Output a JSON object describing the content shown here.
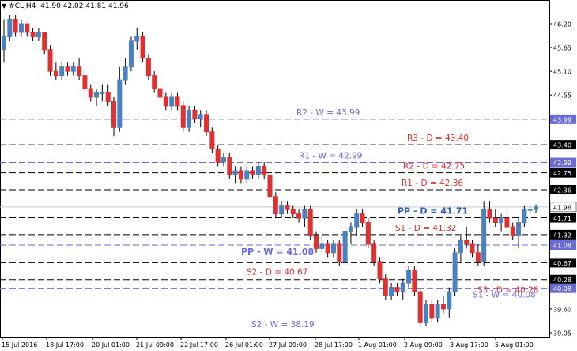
{
  "header": {
    "arrow_icon": "triangle-down-icon",
    "symbol": "#CL,H4",
    "ohlc": "41.90 42.02 41.81 41.96"
  },
  "colors": {
    "bull": "#4a82c0",
    "bear": "#e03030",
    "weekly_line": "#6a6ad8",
    "daily_line": "#000000",
    "current_price_line": "#c8c8c8",
    "weekly_tag_bg": "#6a6ad8",
    "current_tag_bg": "#ffffff"
  },
  "chart_data": {
    "type": "candlestick",
    "symbol": "#CL,H4",
    "y_ticks": [
      "46.20",
      "45.65",
      "45.10",
      "44.55",
      "43.99",
      "43.40",
      "42.99",
      "42.75",
      "42.36",
      "41.96",
      "41.71",
      "41.32",
      "41.08",
      "40.67",
      "40.28",
      "40.08",
      "39.60",
      "39.05"
    ],
    "ylim": [
      39.0,
      46.5
    ],
    "x_ticks": [
      "15 Jul 2016",
      "18 Jul 17:00",
      "20 Jul 01:00",
      "21 Jul 09:00",
      "22 Jul 17:00",
      "26 Jul 01:00",
      "27 Jul 09:00",
      "28 Jul 17:00",
      "1 Aug 01:00",
      "2 Aug 09:00",
      "3 Aug 17:00",
      "5 Aug 01:00"
    ],
    "current_price": 41.96,
    "levels": [
      {
        "label": "R2 - W = 43.99",
        "value": 43.99,
        "kind": "weekly",
        "tag": "43.99"
      },
      {
        "label": "R3 - D = 43.40",
        "value": 43.4,
        "kind": "daily",
        "tag": "43.40"
      },
      {
        "label": "R1 - W = 42.99",
        "value": 42.99,
        "kind": "weekly",
        "tag": "42.99"
      },
      {
        "label": "R2 - D = 42.75",
        "value": 42.75,
        "kind": "daily",
        "tag": "42.75"
      },
      {
        "label": "R1 - D = 42.36",
        "value": 42.36,
        "kind": "daily",
        "tag": "42.36"
      },
      {
        "label": "PP - D = 41.71",
        "value": 41.71,
        "kind": "daily_pp",
        "tag": "41.71"
      },
      {
        "label": "S1 - D = 41.32",
        "value": 41.32,
        "kind": "daily",
        "tag": "41.32"
      },
      {
        "label": "PP - W = 41.08",
        "value": 41.08,
        "kind": "weekly_pp",
        "tag": "41.08"
      },
      {
        "label": "S2 - D = 40.67",
        "value": 40.67,
        "kind": "daily",
        "tag": "40.67"
      },
      {
        "label": "S3 - D = 40.28",
        "value": 40.28,
        "kind": "daily",
        "tag": "40.28"
      },
      {
        "label": "S1 - W = 40.08",
        "value": 40.08,
        "kind": "weekly",
        "tag": "40.08"
      },
      {
        "label": "S2 - W = 38.19",
        "value": 38.19,
        "kind": "weekly_offscale",
        "tag": ""
      }
    ],
    "candles": [
      [
        45.6,
        46.3,
        45.3,
        45.9
      ],
      [
        45.9,
        46.4,
        45.8,
        46.3
      ],
      [
        46.3,
        46.4,
        45.9,
        46.0
      ],
      [
        46.0,
        46.3,
        45.9,
        46.2
      ],
      [
        46.2,
        46.2,
        45.9,
        46.0
      ],
      [
        46.0,
        46.1,
        45.8,
        45.9
      ],
      [
        45.9,
        46.1,
        45.8,
        46.0
      ],
      [
        46.0,
        46.0,
        45.5,
        45.6
      ],
      [
        45.6,
        45.7,
        45.0,
        45.1
      ],
      [
        45.1,
        45.3,
        44.9,
        45.0
      ],
      [
        45.0,
        45.3,
        44.9,
        45.2
      ],
      [
        45.2,
        45.3,
        45.0,
        45.1
      ],
      [
        45.1,
        45.3,
        45.0,
        45.2
      ],
      [
        45.2,
        45.4,
        44.9,
        45.0
      ],
      [
        45.0,
        45.1,
        44.6,
        44.7
      ],
      [
        44.7,
        44.8,
        44.4,
        44.5
      ],
      [
        44.5,
        44.7,
        44.3,
        44.6
      ],
      [
        44.6,
        44.8,
        44.4,
        44.6
      ],
      [
        44.6,
        44.8,
        44.3,
        44.4
      ],
      [
        44.4,
        44.5,
        43.6,
        43.8
      ],
      [
        43.8,
        45.2,
        43.7,
        44.9
      ],
      [
        44.9,
        45.4,
        44.8,
        45.2
      ],
      [
        45.2,
        45.9,
        45.1,
        45.8
      ],
      [
        45.8,
        46.1,
        45.6,
        45.9
      ],
      [
        45.9,
        46.0,
        45.3,
        45.4
      ],
      [
        45.4,
        45.5,
        44.9,
        45.0
      ],
      [
        45.0,
        45.1,
        44.6,
        44.7
      ],
      [
        44.7,
        44.8,
        44.4,
        44.5
      ],
      [
        44.5,
        44.6,
        44.2,
        44.3
      ],
      [
        44.3,
        44.6,
        44.2,
        44.5
      ],
      [
        44.5,
        44.6,
        44.2,
        44.3
      ],
      [
        44.3,
        44.4,
        43.7,
        43.8
      ],
      [
        43.8,
        44.3,
        43.7,
        44.2
      ],
      [
        44.2,
        44.3,
        43.9,
        44.0
      ],
      [
        44.0,
        44.2,
        43.8,
        44.1
      ],
      [
        44.1,
        44.2,
        43.6,
        43.7
      ],
      [
        43.7,
        43.8,
        43.2,
        43.3
      ],
      [
        43.3,
        43.4,
        42.9,
        43.0
      ],
      [
        43.0,
        43.2,
        42.9,
        43.1
      ],
      [
        43.1,
        43.2,
        42.6,
        42.7
      ],
      [
        42.7,
        42.9,
        42.5,
        42.8
      ],
      [
        42.8,
        42.9,
        42.5,
        42.6
      ],
      [
        42.6,
        42.9,
        42.5,
        42.8
      ],
      [
        42.8,
        42.9,
        42.6,
        42.7
      ],
      [
        42.7,
        43.0,
        42.6,
        42.9
      ],
      [
        42.9,
        43.0,
        42.6,
        42.7
      ],
      [
        42.7,
        42.8,
        42.1,
        42.2
      ],
      [
        42.2,
        42.3,
        41.7,
        41.8
      ],
      [
        41.8,
        42.1,
        41.7,
        42.0
      ],
      [
        42.0,
        42.1,
        41.8,
        41.9
      ],
      [
        41.9,
        42.0,
        41.7,
        41.8
      ],
      [
        41.8,
        41.9,
        41.6,
        41.7
      ],
      [
        41.7,
        42.0,
        41.5,
        41.9
      ],
      [
        41.9,
        42.0,
        41.2,
        41.3
      ],
      [
        41.3,
        41.4,
        40.9,
        41.0
      ],
      [
        41.0,
        41.3,
        40.9,
        41.1
      ],
      [
        41.1,
        41.2,
        40.8,
        40.9
      ],
      [
        40.9,
        41.2,
        40.8,
        41.1
      ],
      [
        41.1,
        41.2,
        40.6,
        40.7
      ],
      [
        40.7,
        41.5,
        40.6,
        41.4
      ],
      [
        41.4,
        41.6,
        41.1,
        41.5
      ],
      [
        41.5,
        41.9,
        41.3,
        41.8
      ],
      [
        41.8,
        41.9,
        41.5,
        41.6
      ],
      [
        41.6,
        41.7,
        41.0,
        41.1
      ],
      [
        41.1,
        41.2,
        40.6,
        40.7
      ],
      [
        40.7,
        40.8,
        40.2,
        40.3
      ],
      [
        40.3,
        40.4,
        39.8,
        39.9
      ],
      [
        39.9,
        40.2,
        39.8,
        40.1
      ],
      [
        40.1,
        40.2,
        39.9,
        40.0
      ],
      [
        40.0,
        40.3,
        39.8,
        40.2
      ],
      [
        40.2,
        40.6,
        40.1,
        40.5
      ],
      [
        40.5,
        40.6,
        39.9,
        40.0
      ],
      [
        40.0,
        40.1,
        39.2,
        39.3
      ],
      [
        39.3,
        39.8,
        39.2,
        39.7
      ],
      [
        39.7,
        39.8,
        39.3,
        39.4
      ],
      [
        39.4,
        39.8,
        39.3,
        39.7
      ],
      [
        39.7,
        39.9,
        39.5,
        39.6
      ],
      [
        39.6,
        40.1,
        39.4,
        40.0
      ],
      [
        40.0,
        41.0,
        39.9,
        40.9
      ],
      [
        40.9,
        41.3,
        40.7,
        41.2
      ],
      [
        41.2,
        41.5,
        41.0,
        41.1
      ],
      [
        41.1,
        41.2,
        40.8,
        40.9
      ],
      [
        40.9,
        41.1,
        40.6,
        40.7
      ],
      [
        40.7,
        42.1,
        40.6,
        41.9
      ],
      [
        41.9,
        42.1,
        41.6,
        41.7
      ],
      [
        41.7,
        41.9,
        41.5,
        41.6
      ],
      [
        41.6,
        41.8,
        41.4,
        41.7
      ],
      [
        41.7,
        41.9,
        41.3,
        41.5
      ],
      [
        41.5,
        41.6,
        41.2,
        41.3
      ],
      [
        41.3,
        41.7,
        41.0,
        41.6
      ],
      [
        41.6,
        42.0,
        41.5,
        41.9
      ],
      [
        41.9,
        42.0,
        41.8,
        41.9
      ],
      [
        41.9,
        42.02,
        41.81,
        41.96
      ]
    ]
  }
}
